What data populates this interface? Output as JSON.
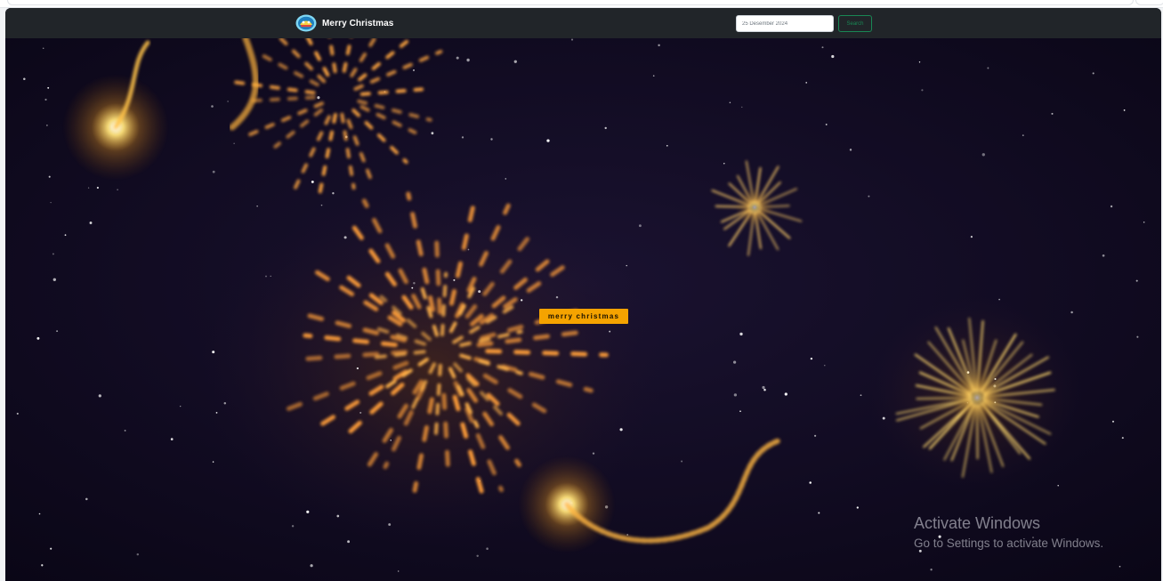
{
  "navbar": {
    "brand_text": "Merry Christmas",
    "date_value": "25 Desember 2024",
    "search_label": "Search"
  },
  "banner": {
    "text": "merry christmas"
  },
  "watermark": {
    "title": "Activate Windows",
    "subtitle": "Go to Settings to activate Windows."
  },
  "colors": {
    "navbar_bg": "#212529",
    "sky": "#0e0a1c",
    "banner_bg": "#f5a300",
    "search_outline": "#198754",
    "firework_gold": "#ffcf5a"
  },
  "icons": {
    "logo": "christmas-badge-icon"
  }
}
